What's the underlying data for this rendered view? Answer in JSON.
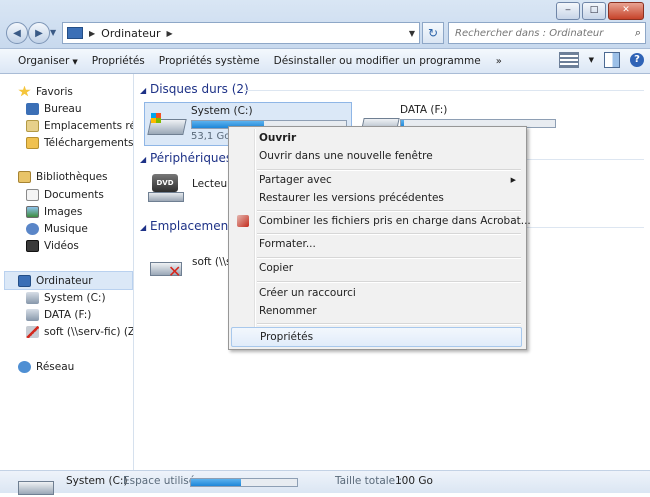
{
  "window": {
    "controls": {
      "minimize": "‒",
      "maximize": "□",
      "close": "✕"
    }
  },
  "address": {
    "location": "Ordinateur",
    "search_placeholder": "Rechercher dans : Ordinateur"
  },
  "toolbar": {
    "organize": "Organiser",
    "properties": "Propriétés",
    "system_properties": "Propriétés système",
    "uninstall": "Désinstaller ou modifier un programme",
    "more": "»"
  },
  "nav": {
    "favorites": "Favoris",
    "desktop": "Bureau",
    "recent": "Emplacements récents",
    "downloads": "Téléchargements",
    "libraries": "Bibliothèques",
    "documents": "Documents",
    "images": "Images",
    "music": "Musique",
    "videos": "Vidéos",
    "computer": "Ordinateur",
    "system_c": "System (C:)",
    "data_f": "DATA (F:)",
    "soft_z": "soft (\\\\serv-fic) (Z:)",
    "network": "Réseau"
  },
  "content": {
    "hard_drives_header": "Disques durs (2)",
    "devices_header": "Périphériques",
    "network_header": "Emplacement",
    "system_drive": {
      "name": "System (C:)",
      "free": "53,1 Go l",
      "usage": 0.47
    },
    "data_drive": {
      "name": "DATA (F:)",
      "usage": 0.02
    },
    "dvd_drive": {
      "name": "Lecteur D"
    },
    "net_drive": {
      "name": "soft (\\\\se"
    }
  },
  "context_menu": {
    "open": "Ouvrir",
    "open_new_window": "Ouvrir dans une nouvelle fenêtre",
    "share_with": "Partager avec",
    "restore_previous": "Restaurer les versions précédentes",
    "combine_acrobat": "Combiner les fichiers pris en charge dans Acrobat...",
    "format": "Formater...",
    "copy": "Copier",
    "create_shortcut": "Créer un raccourci",
    "rename": "Renommer",
    "properties": "Propriétés"
  },
  "details": {
    "name": "System (C:)",
    "used_label": "Espace utilisé :",
    "usage": 0.47,
    "total_label": "Taille totale :",
    "total_value": "100 Go"
  }
}
